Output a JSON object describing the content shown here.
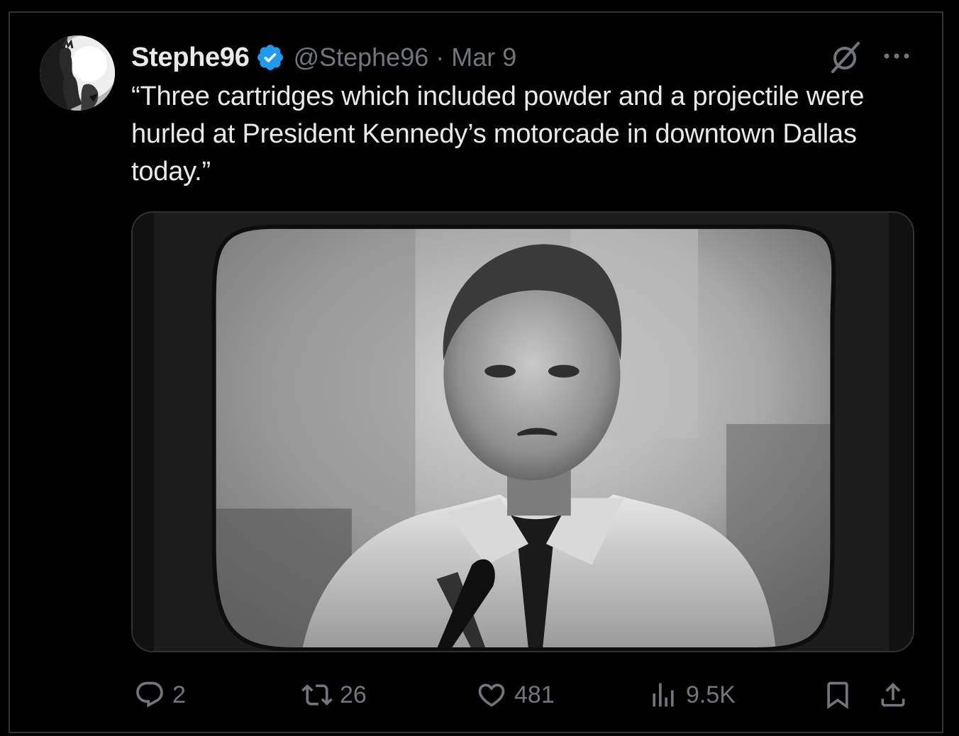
{
  "author": {
    "display_name": "Stephe96",
    "handle": "@Stephe96",
    "separator": "·",
    "date": "Mar 9"
  },
  "tweet": {
    "text": "“Three cartridges which included powder and a projectile were hurled at President Kennedy’s motorcade in downtown Dallas today.”"
  },
  "actions": {
    "replies": "2",
    "reposts": "26",
    "likes": "481",
    "views": "9.5K"
  },
  "colors": {
    "background": "#000000",
    "text": "#e7e9ea",
    "muted": "#71767b",
    "border": "#2f3336",
    "verified": "#1d9bf0"
  },
  "icons": {
    "verified": "verified-badge-icon",
    "grok": "grok-icon",
    "more": "more-icon",
    "reply": "reply-icon",
    "repost": "repost-icon",
    "like": "heart-icon",
    "views": "views-icon",
    "bookmark": "bookmark-icon",
    "share": "share-icon"
  }
}
